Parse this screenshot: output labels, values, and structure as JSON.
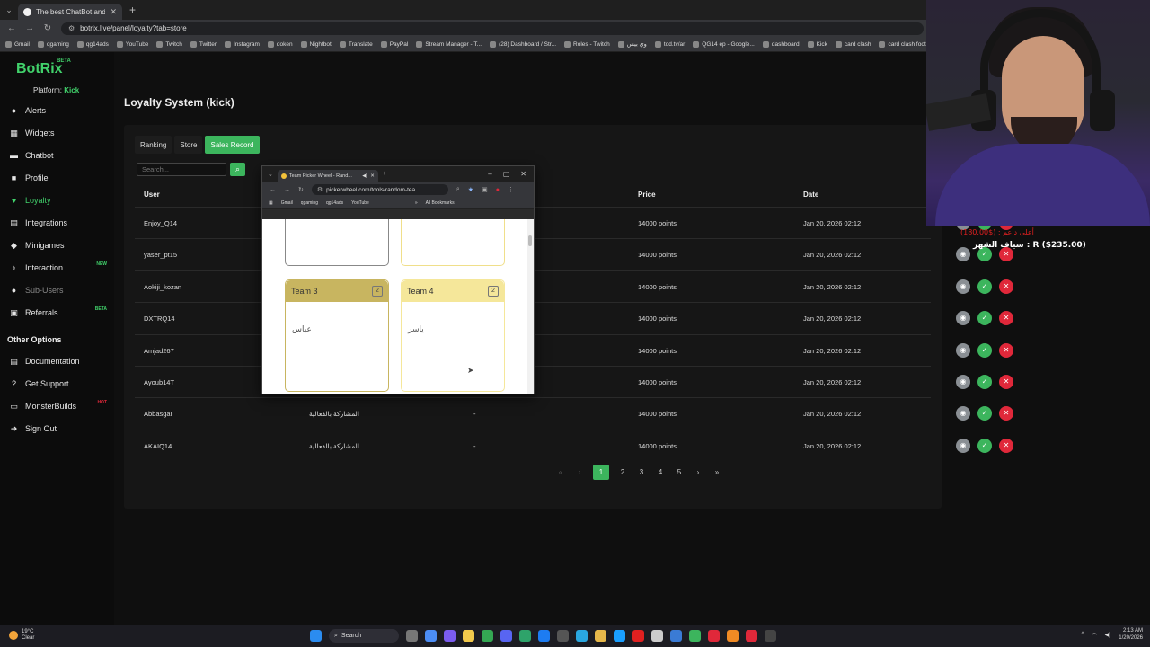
{
  "browser": {
    "tab_title": "The best ChatBot and Widgets",
    "url": "botrix.live/panel/loyalty?tab=store",
    "bookmarks": [
      "Gmail",
      "qgaming",
      "qg14ads",
      "YouTube",
      "Twitch",
      "Twitter",
      "Instagram",
      "doken",
      "Nightbot",
      "Translate",
      "PayPal",
      "Stream Manager - T...",
      "(28) Dashboard / Str...",
      "Roles - Twitch",
      "وي بيس",
      "tod.tv/ar",
      "QG14 ep - Google...",
      "dashboard",
      "Kick",
      "card clash",
      "card clash football"
    ]
  },
  "app": {
    "logo": "BotRix",
    "logo_badge": "BETA",
    "platform_label": "Platform:",
    "platform_value": "Kick",
    "nav": [
      {
        "label": "Alerts",
        "icon": "bell-icon",
        "glyph": "●"
      },
      {
        "label": "Widgets",
        "icon": "widgets-icon",
        "glyph": "▦"
      },
      {
        "label": "Chatbot",
        "icon": "chatbot-icon",
        "glyph": "▬"
      },
      {
        "label": "Profile",
        "icon": "profile-icon",
        "glyph": "■"
      },
      {
        "label": "Loyalty",
        "icon": "heart-icon",
        "glyph": "♥"
      },
      {
        "label": "Integrations",
        "icon": "integrations-icon",
        "glyph": "▤"
      },
      {
        "label": "Minigames",
        "icon": "gamepad-icon",
        "glyph": "◆"
      },
      {
        "label": "Interaction",
        "icon": "music-icon",
        "glyph": "♪",
        "badge": "NEW"
      },
      {
        "label": "Sub-Users",
        "icon": "users-icon",
        "glyph": "●"
      },
      {
        "label": "Referrals",
        "icon": "referrals-icon",
        "glyph": "▣",
        "badge": "BETA"
      }
    ],
    "other_title": "Other Options",
    "other_nav": [
      {
        "label": "Documentation",
        "icon": "document-icon",
        "glyph": "▤"
      },
      {
        "label": "Get Support",
        "icon": "help-icon",
        "glyph": "?"
      },
      {
        "label": "MonsterBuilds",
        "icon": "monitor-icon",
        "glyph": "▭",
        "badge": "HOT"
      },
      {
        "label": "Sign Out",
        "icon": "sign-out-icon",
        "glyph": "➜"
      }
    ]
  },
  "page": {
    "title": "Loyalty System (kick)",
    "tabs": [
      "Ranking",
      "Store",
      "Sales Record"
    ],
    "search_placeholder": "Search...",
    "headers": {
      "user": "User",
      "price": "Price",
      "date": "Date"
    },
    "rows": [
      {
        "user": "Enjoy_Q14",
        "item": "",
        "note": "",
        "price": "14000 points",
        "date": "Jan 20, 2026 02:12"
      },
      {
        "user": "yaser_pt15",
        "item": "",
        "note": "",
        "price": "14000 points",
        "date": "Jan 20, 2026 02:12"
      },
      {
        "user": "Aokiji_kozan",
        "item": "",
        "note": "",
        "price": "14000 points",
        "date": "Jan 20, 2026 02:12"
      },
      {
        "user": "DXTRQ14",
        "item": "",
        "note": "",
        "price": "14000 points",
        "date": "Jan 20, 2026 02:12"
      },
      {
        "user": "Amjad267",
        "item": "",
        "note": "",
        "price": "14000 points",
        "date": "Jan 20, 2026 02:12"
      },
      {
        "user": "Ayoub14T",
        "item": "",
        "note": "",
        "price": "14000 points",
        "date": "Jan 20, 2026 02:12"
      },
      {
        "user": "Abbasgar",
        "item": "المشاركة بالفعالية",
        "note": "-",
        "price": "14000 points",
        "date": "Jan 20, 2026 02:12"
      },
      {
        "user": "AKAIQ14",
        "item": "المشاركة بالفعالية",
        "note": "-",
        "price": "14000 points",
        "date": "Jan 20, 2026 02:12"
      }
    ],
    "pagination": [
      "«",
      "‹",
      "1",
      "2",
      "3",
      "4",
      "5",
      "›",
      "»"
    ]
  },
  "popup": {
    "tab_title": "Team Picker Wheel - Rand...",
    "url": "pickerwheel.com/tools/random-tea...",
    "bookmarks": [
      "Gmail",
      "qgaming",
      "qg14ads",
      "YouTube"
    ],
    "all_bookmarks": "All Bookmarks",
    "teams": [
      {
        "name": "Team 3",
        "count": "2",
        "member": "عباس",
        "color": "#c8b560"
      },
      {
        "name": "Team 4",
        "count": "2",
        "member": "ياسر",
        "color": "#f5e79a"
      }
    ]
  },
  "overlay": {
    "line1": "سياف الشهر : R ($235.00)",
    "line2": "أعلى داعم : ($180.00)"
  },
  "taskbar": {
    "temp": "19°C",
    "weather": "Clear",
    "search": "Search",
    "time": "2:13 AM",
    "date": "1/20/2026"
  }
}
